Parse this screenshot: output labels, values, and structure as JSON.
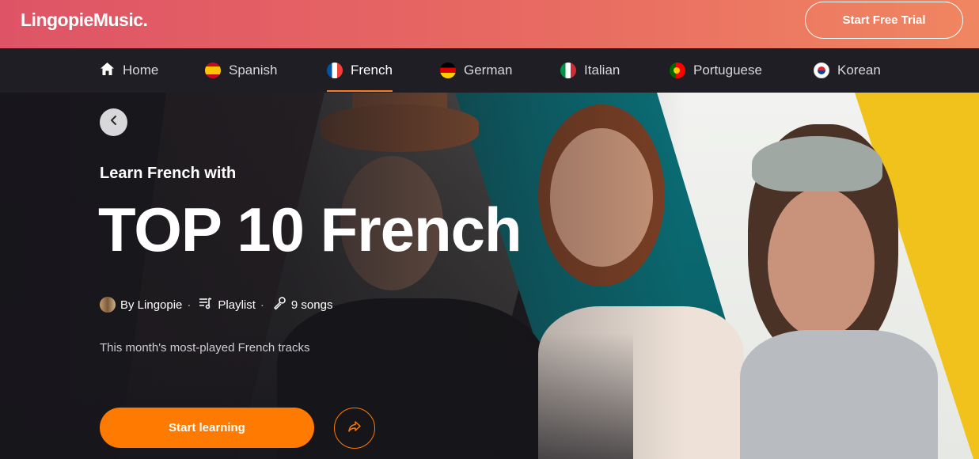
{
  "header": {
    "logo": "LingopieMusic.",
    "trial_label": "Start Free Trial"
  },
  "nav": {
    "items": [
      {
        "label": "Home",
        "icon": "home-icon"
      },
      {
        "label": "Spanish",
        "icon": "spain-flag-icon"
      },
      {
        "label": "French",
        "icon": "france-flag-icon",
        "active": true
      },
      {
        "label": "German",
        "icon": "germany-flag-icon"
      },
      {
        "label": "Italian",
        "icon": "italy-flag-icon"
      },
      {
        "label": "Portuguese",
        "icon": "portugal-flag-icon"
      },
      {
        "label": "Korean",
        "icon": "korea-flag-icon"
      }
    ]
  },
  "hero": {
    "eyebrow": "Learn French with",
    "title": "TOP 10 French",
    "author": "By Lingopie",
    "type": "Playlist",
    "songs": "9 songs",
    "description": "This month's most-played French tracks",
    "start_label": "Start learning"
  },
  "colors": {
    "accent": "#ff7a00",
    "header_start": "#de5466",
    "header_end": "#f08661",
    "nav_bg": "#1f1e24"
  }
}
